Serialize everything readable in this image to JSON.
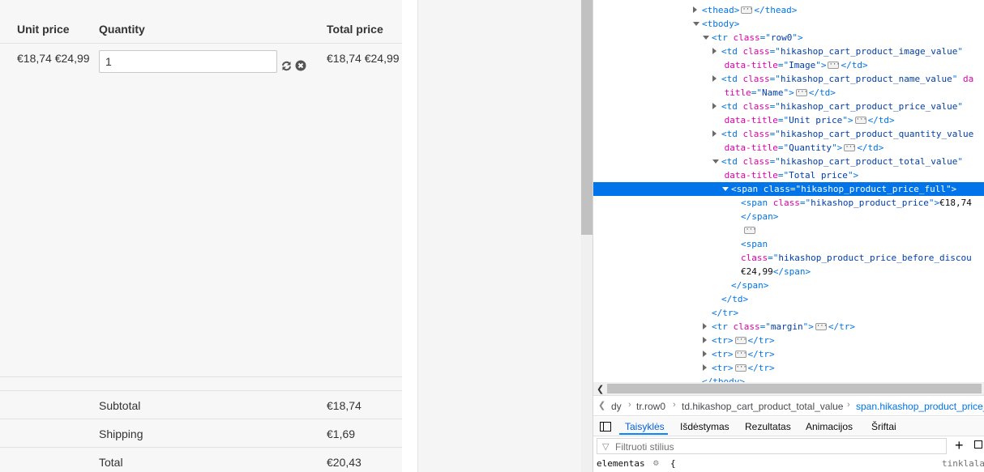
{
  "cart": {
    "headers": {
      "unit_price": "Unit price",
      "quantity": "Quantity",
      "total_price": "Total price"
    },
    "row": {
      "unit_price": "€18,74 €24,99",
      "quantity": "1",
      "total_price": "€18,74 €24,99"
    },
    "icons": {
      "refresh": "refresh-icon",
      "remove": "remove-icon"
    },
    "totals": [
      {
        "label": "Subtotal",
        "value": "€18,74"
      },
      {
        "label": "Shipping",
        "value": "€1,69"
      },
      {
        "label": "Total",
        "value": "€20,43"
      }
    ]
  },
  "devtools": {
    "tree": [
      {
        "indent": 0,
        "twisty": "closed",
        "parts": [
          [
            "tg",
            "<thead>"
          ],
          [
            "ell",
            ""
          ],
          [
            "tg",
            "</thead>"
          ]
        ]
      },
      {
        "indent": 0,
        "twisty": "open",
        "parts": [
          [
            "tg",
            "<tbody>"
          ]
        ]
      },
      {
        "indent": 1,
        "twisty": "open",
        "parts": [
          [
            "tg",
            "<tr "
          ],
          [
            "an",
            "class"
          ],
          [
            "tg",
            "=\""
          ],
          [
            "av",
            "row0"
          ],
          [
            "tg",
            "\">"
          ]
        ]
      },
      {
        "indent": 2,
        "twisty": "closed",
        "parts": [
          [
            "tg",
            "<td "
          ],
          [
            "an",
            "class"
          ],
          [
            "tg",
            "=\""
          ],
          [
            "av",
            "hikashop_cart_product_image_value"
          ],
          [
            "tg",
            "\""
          ]
        ]
      },
      {
        "indent": 2.3,
        "twisty": "",
        "parts": [
          [
            "an",
            "data-title"
          ],
          [
            "tg",
            "=\""
          ],
          [
            "av",
            "Image"
          ],
          [
            "tg",
            "\">"
          ],
          [
            "ell",
            ""
          ],
          [
            "tg",
            "</td>"
          ]
        ]
      },
      {
        "indent": 2,
        "twisty": "closed",
        "parts": [
          [
            "tg",
            "<td "
          ],
          [
            "an",
            "class"
          ],
          [
            "tg",
            "=\""
          ],
          [
            "av",
            "hikashop_cart_product_name_value"
          ],
          [
            "tg",
            "\" "
          ],
          [
            "an",
            "da"
          ]
        ]
      },
      {
        "indent": 2.3,
        "twisty": "",
        "parts": [
          [
            "an",
            "title"
          ],
          [
            "tg",
            "=\""
          ],
          [
            "av",
            "Name"
          ],
          [
            "tg",
            "\">"
          ],
          [
            "ell",
            ""
          ],
          [
            "tg",
            "</td>"
          ]
        ]
      },
      {
        "indent": 2,
        "twisty": "closed",
        "parts": [
          [
            "tg",
            "<td "
          ],
          [
            "an",
            "class"
          ],
          [
            "tg",
            "=\""
          ],
          [
            "av",
            "hikashop_cart_product_price_value"
          ],
          [
            "tg",
            "\""
          ]
        ]
      },
      {
        "indent": 2.3,
        "twisty": "",
        "parts": [
          [
            "an",
            "data-title"
          ],
          [
            "tg",
            "=\""
          ],
          [
            "av",
            "Unit price"
          ],
          [
            "tg",
            "\">"
          ],
          [
            "ell",
            ""
          ],
          [
            "tg",
            "</td>"
          ]
        ]
      },
      {
        "indent": 2,
        "twisty": "closed",
        "parts": [
          [
            "tg",
            "<td "
          ],
          [
            "an",
            "class"
          ],
          [
            "tg",
            "=\""
          ],
          [
            "av",
            "hikashop_cart_product_quantity_value"
          ]
        ]
      },
      {
        "indent": 2.3,
        "twisty": "",
        "parts": [
          [
            "an",
            "data-title"
          ],
          [
            "tg",
            "=\""
          ],
          [
            "av",
            "Quantity"
          ],
          [
            "tg",
            "\">"
          ],
          [
            "ell",
            ""
          ],
          [
            "tg",
            "</td>"
          ]
        ]
      },
      {
        "indent": 2,
        "twisty": "open",
        "parts": [
          [
            "tg",
            "<td "
          ],
          [
            "an",
            "class"
          ],
          [
            "tg",
            "=\""
          ],
          [
            "av",
            "hikashop_cart_product_total_value"
          ],
          [
            "tg",
            "\""
          ]
        ]
      },
      {
        "indent": 2.3,
        "twisty": "",
        "parts": [
          [
            "an",
            "data-title"
          ],
          [
            "tg",
            "=\""
          ],
          [
            "av",
            "Total price"
          ],
          [
            "tg",
            "\">"
          ]
        ]
      },
      {
        "indent": 3,
        "twisty": "open",
        "selected": true,
        "parts": [
          [
            "tg",
            "<span "
          ],
          [
            "an",
            "class"
          ],
          [
            "tg",
            "=\""
          ],
          [
            "av",
            "hikashop_product_price_full"
          ],
          [
            "tg",
            "\">"
          ]
        ]
      },
      {
        "indent": 4,
        "twisty": "",
        "parts": [
          [
            "tg",
            "<span "
          ],
          [
            "an",
            "class"
          ],
          [
            "tg",
            "=\""
          ],
          [
            "av",
            "hikashop_product_price"
          ],
          [
            "tg",
            "\">"
          ],
          [
            "tx",
            "€18,74"
          ]
        ]
      },
      {
        "indent": 4,
        "twisty": "",
        "parts": [
          [
            "tg",
            "</span>"
          ]
        ]
      },
      {
        "indent": 4.2,
        "twisty": "",
        "parts": [
          [
            "ell",
            ""
          ]
        ]
      },
      {
        "indent": 4,
        "twisty": "",
        "parts": [
          [
            "tg",
            "<span"
          ]
        ]
      },
      {
        "indent": 4,
        "twisty": "",
        "parts": [
          [
            "an",
            "class"
          ],
          [
            "tg",
            "=\""
          ],
          [
            "av",
            "hikashop_product_price_before_discou"
          ]
        ]
      },
      {
        "indent": 4,
        "twisty": "",
        "parts": [
          [
            "tx",
            "€24,99"
          ],
          [
            "tg",
            "</span>"
          ]
        ]
      },
      {
        "indent": 3,
        "twisty": "",
        "parts": [
          [
            "tg",
            "</span>"
          ]
        ]
      },
      {
        "indent": 2,
        "twisty": "",
        "parts": [
          [
            "tg",
            "</td>"
          ]
        ]
      },
      {
        "indent": 1,
        "twisty": "",
        "parts": [
          [
            "tg",
            "</tr>"
          ]
        ]
      },
      {
        "indent": 1,
        "twisty": "closed",
        "parts": [
          [
            "tg",
            "<tr "
          ],
          [
            "an",
            "class"
          ],
          [
            "tg",
            "=\""
          ],
          [
            "av",
            "margin"
          ],
          [
            "tg",
            "\">"
          ],
          [
            "ell",
            ""
          ],
          [
            "tg",
            "</tr>"
          ]
        ]
      },
      {
        "indent": 1,
        "twisty": "closed",
        "parts": [
          [
            "tg",
            "<tr>"
          ],
          [
            "ell",
            ""
          ],
          [
            "tg",
            "</tr>"
          ]
        ]
      },
      {
        "indent": 1,
        "twisty": "closed",
        "parts": [
          [
            "tg",
            "<tr>"
          ],
          [
            "ell",
            ""
          ],
          [
            "tg",
            "</tr>"
          ]
        ]
      },
      {
        "indent": 1,
        "twisty": "closed",
        "parts": [
          [
            "tg",
            "<tr>"
          ],
          [
            "ell",
            ""
          ],
          [
            "tg",
            "</tr>"
          ]
        ]
      },
      {
        "indent": 0,
        "twisty": "",
        "parts": [
          [
            "tg",
            "</tbody>"
          ]
        ]
      }
    ],
    "breadcrumbs": [
      "dy",
      "tr.row0",
      "td.hikashop_cart_product_total_value",
      "span.hikashop_product_price_"
    ],
    "tabs": [
      "Taisyklės",
      "Išdėstymas",
      "Rezultatas",
      "Animacijos",
      "Šriftai"
    ],
    "active_tab": 0,
    "filter_placeholder": "Filtruoti stilius",
    "rule": {
      "selector": "elementas",
      "brace": "{",
      "source": "tinklala"
    },
    "colors": {
      "selected_bg": "#0074e8",
      "tag": "#0074e8",
      "attr_name": "#dd00a9",
      "attr_value": "#003eaa"
    }
  }
}
